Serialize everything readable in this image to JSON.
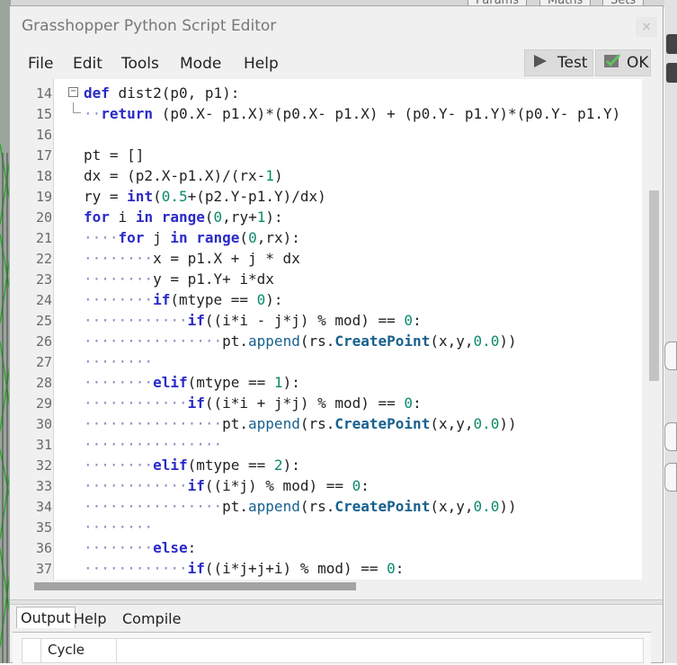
{
  "window": {
    "title": "Grasshopper Python Script Editor",
    "close_glyph": "×"
  },
  "background": {
    "tabs": [
      "Params",
      "Maths",
      "Sets"
    ]
  },
  "menu": [
    "File",
    "Edit",
    "Tools",
    "Mode",
    "Help"
  ],
  "toolbar": {
    "test_label": "Test",
    "ok_label": "OK",
    "test_icon": "play-triangle-icon",
    "ok_icon": "check-box-icon"
  },
  "editor": {
    "lines": [
      {
        "n": "14",
        "t": "def dist2(p0, p1):"
      },
      {
        "n": "15",
        "t": "··return (p0.X- p1.X)*(p0.X- p1.X) + (p0.Y- p1.Y)*(p0.Y- p1.Y)"
      },
      {
        "n": "16",
        "t": ""
      },
      {
        "n": "17",
        "t": "pt = []"
      },
      {
        "n": "18",
        "t": "dx = (p2.X-p1.X)/(rx-1)"
      },
      {
        "n": "19",
        "t": "ry = int(0.5+(p2.Y-p1.Y)/dx)"
      },
      {
        "n": "20",
        "t": "for i in range(0,ry+1):"
      },
      {
        "n": "21",
        "t": "····for j in range(0,rx):"
      },
      {
        "n": "22",
        "t": "········x = p1.X + j * dx"
      },
      {
        "n": "23",
        "t": "········y = p1.Y+ i*dx"
      },
      {
        "n": "24",
        "t": "········if(mtype == 0):"
      },
      {
        "n": "25",
        "t": "············if((i*i - j*j) % mod) == 0:"
      },
      {
        "n": "26",
        "t": "················pt.append(rs.CreatePoint(x,y,0.0))"
      },
      {
        "n": "27",
        "t": "········"
      },
      {
        "n": "28",
        "t": "········elif(mtype == 1):"
      },
      {
        "n": "29",
        "t": "············if((i*i + j*j) % mod) == 0:"
      },
      {
        "n": "30",
        "t": "················pt.append(rs.CreatePoint(x,y,0.0))"
      },
      {
        "n": "31",
        "t": "················"
      },
      {
        "n": "32",
        "t": "········elif(mtype == 2):"
      },
      {
        "n": "33",
        "t": "············if((i*j) % mod) == 0:"
      },
      {
        "n": "34",
        "t": "················pt.append(rs.CreatePoint(x,y,0.0))"
      },
      {
        "n": "35",
        "t": "········"
      },
      {
        "n": "36",
        "t": "········else:"
      },
      {
        "n": "37",
        "t": "············if((i*j+j+i) % mod) == 0:"
      }
    ]
  },
  "bottom_tabs": [
    "Output",
    "Help",
    "Compile"
  ],
  "output": {
    "column_label": "Cycle"
  },
  "colors": {
    "keyword": "#2a2ac8",
    "function": "#17608d",
    "number": "#0a8a6a",
    "whitespace_dot": "#8a8ac8"
  }
}
